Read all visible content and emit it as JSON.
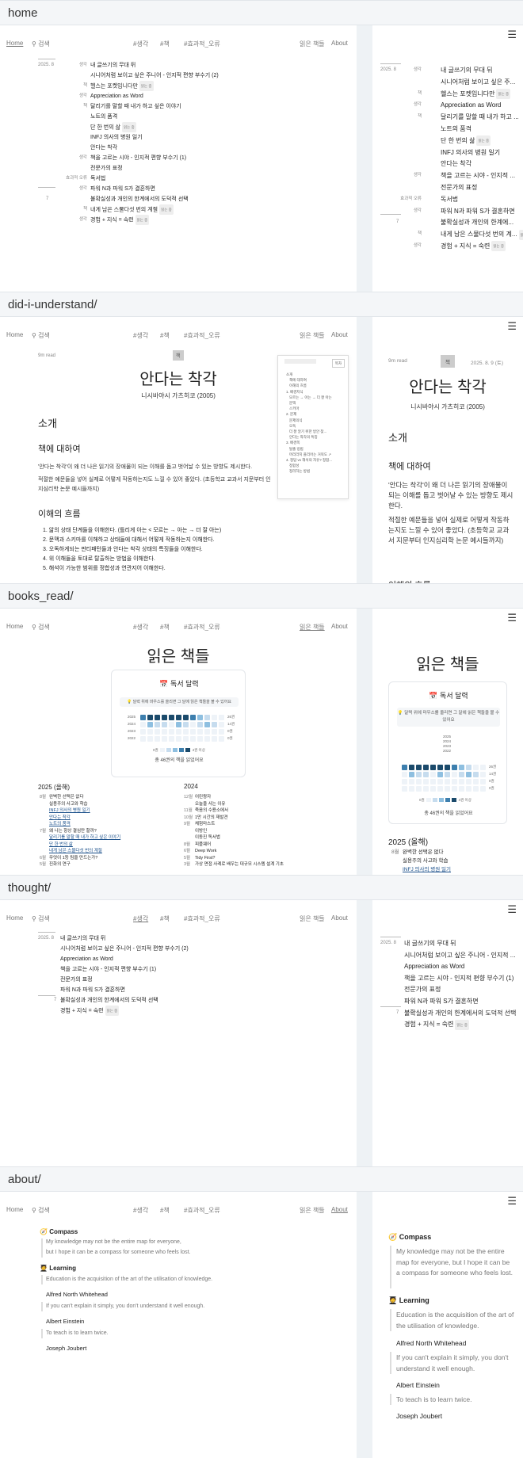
{
  "sections": {
    "home": "home",
    "did_i_understand": "did-i-understand/",
    "books_read": "books_read/",
    "thought": "thought/",
    "about": "about/"
  },
  "nav": {
    "home": "Home",
    "search": "검색",
    "tag_thought": "#생각",
    "tag_book": "#책",
    "tag_effective": "#효과적_오류",
    "books_read": "읽은 책들",
    "about": "About"
  },
  "home_list": {
    "year": "2025. 8",
    "seven": "7",
    "items": [
      {
        "tag": "생각",
        "title": "내 글쓰기의 무대 뒤",
        "badge": ""
      },
      {
        "tag": "",
        "title": "시니어처럼 보이고 싶은 주니어 - 인지적 편향 부수기 (2)",
        "badge": ""
      },
      {
        "tag": "책",
        "title": "헬스는 포켓입니다만",
        "badge": "읽는 중"
      },
      {
        "tag": "생각",
        "title": "Appreciation as Word",
        "badge": ""
      },
      {
        "tag": "책",
        "title": "달리기를 말할 때 내가 하고 싶은 이야기",
        "badge": ""
      },
      {
        "tag": "",
        "title": "노트의 품격",
        "badge": ""
      },
      {
        "tag": "",
        "title": "단 한 번의 삶",
        "badge": "읽는 중"
      },
      {
        "tag": "",
        "title": "INFJ 의사의 병원 일기",
        "badge": ""
      },
      {
        "tag": "",
        "title": "안다는 착각",
        "badge": ""
      },
      {
        "tag": "생각",
        "title": "책을 고르는 시야 - 인지적 편향 부수기 (1)",
        "badge": ""
      },
      {
        "tag": "",
        "title": "전문가의 표정",
        "badge": ""
      },
      {
        "tag": "효과적 오류",
        "title": "독서법",
        "badge": ""
      },
      {
        "tag": "생각",
        "title": "파워 N과 파워 S가 결혼하면",
        "badge": ""
      },
      {
        "tag": "",
        "title": "불확실성과 개인의 한계에서의 도덕적 선택",
        "badge": ""
      },
      {
        "tag": "책",
        "title": "내게 남은 스물다섯 번의 계절",
        "badge": "읽는 중"
      },
      {
        "tag": "생각",
        "title": "경험 + 지식 = 숙련",
        "badge": "읽는 중"
      }
    ],
    "right_items": [
      "내 글쓰기의 무대 뒤",
      "시니어처럼 보이고 싶은 주...",
      "헬스는 포켓입니다만",
      "Appreciation as Word",
      "달리기를 말할 때 내가 하고 ...",
      "노트의 품격",
      "단 한 번의 삶",
      "INFJ 의사의 병원 일기",
      "안다는 착각",
      "책을 고르는 시야 - 인지적 ...",
      "전문가의 표정",
      "독서법",
      "파워 N과 파워 S가 결혼하면",
      "불확실성과 개인의 한계에...",
      "내게 남은 스물다섯 번의 계...",
      "경험 + 지식 = 숙련"
    ]
  },
  "article": {
    "read_time": "9m read",
    "tag": "책",
    "date": "2025. 8. 9 (토)",
    "title": "안다는 착각",
    "subtitle": "니시바야시 가츠히코 (2005)",
    "h_intro": "소개",
    "h_about": "책에 대하여",
    "p1": "'안다는 착각'이 왜 더 나은 읽기의 장애물이 되는 이해를 돕고 벗어날 수 있는 방향도 제시한다.",
    "p2": "적절한 예문들을 넣어 실제로 어떻게 작동하는지도 느낄 수 있어 좋았다. (초등학교 교과서 지문부터 인지심리학 논문 예시들까지)",
    "p1_r": "'안다는 착각'이 왜 더 나은 읽기의 장애물이 되는 이해를 돕고 벗어날 수 있는 방향도 제시한다.",
    "p2_r": "적절한 예문들을 넣어 실제로 어떻게 작동하는지도 느낄 수 있어 좋았다. (초등학교 교과서 지문부터 인지심리학 논문 예시들까지)",
    "h_flow": "이해의 흐름",
    "flow": [
      "1. 앎의 상태 단계들을 이해한다. (틀리게 아는 < 모르는 → 아는 → 더 잘 아는)",
      "2. 문맥과 스키마를 이해하고 상태들에 대해서 어떻게 작동하는지 이해한다.",
      "3. 오독하게되는 판티패턴들과 안다는 착각 상태의 특징들을 이해한다.",
      "4. 위 이해들을 토대로 탈출하는 방법을 이해한다.",
      "5. 해석이 가능한 범위를 정합성과 연관지어 이해한다."
    ],
    "toc_btn": "목차",
    "toc": [
      {
        "t": "소개",
        "sub": false
      },
      {
        "t": "책에 대하여",
        "sub": true
      },
      {
        "t": "이해의 흐름",
        "sub": true
      },
      {
        "t": "1. 배경지식",
        "sub": false
      },
      {
        "t": "모르는 → 아는 → 더 잘 아는",
        "sub": true
      },
      {
        "t": "문맥",
        "sub": true
      },
      {
        "t": "스키마",
        "sub": true
      },
      {
        "t": "2. 문제",
        "sub": false
      },
      {
        "t": "문제의식",
        "sub": true
      },
      {
        "t": "오독",
        "sub": true
      },
      {
        "t": "더 잘 알기 위한 방안 찾...",
        "sub": true
      },
      {
        "t": "안다는 착각의 특징",
        "sub": true
      },
      {
        "t": "3. 배경쪽",
        "sub": false
      },
      {
        "t": "탈출 방법",
        "sub": true
      },
      {
        "t": "머리라지 플리어는 거북도 ↗",
        "sub": true
      },
      {
        "t": "4. 정답 vs 해석의 자유? 정합...",
        "sub": false
      },
      {
        "t": "정합성",
        "sub": true
      },
      {
        "t": "정리하는 방법",
        "sub": true
      }
    ],
    "h_flow_r": "이해의 흐름"
  },
  "books": {
    "title": "읽은 책들",
    "calendar_title": "독서 달력",
    "calendar_icon": "calendar-icon",
    "hint": "달력 위에 마우스를 올리면 그 달에 읽은 책들을 볼 수 있어요",
    "years": [
      "2025",
      "2024",
      "2023",
      "2022"
    ],
    "counts": [
      "26권",
      "14권",
      "0권",
      "0권"
    ],
    "legend_low": "0권",
    "legend_high": "4권 이상",
    "total": "총 46권의 책을 읽었어요",
    "heatmap": [
      [
        3,
        4,
        4,
        4,
        4,
        4,
        4,
        3,
        2,
        1,
        0,
        0
      ],
      [
        0,
        2,
        1,
        1,
        0,
        2,
        1,
        0,
        1,
        2,
        1,
        0
      ],
      [
        0,
        0,
        0,
        0,
        0,
        0,
        0,
        0,
        0,
        0,
        0,
        0
      ],
      [
        0,
        0,
        0,
        0,
        0,
        0,
        0,
        0,
        0,
        0,
        0,
        0
      ]
    ],
    "col_2025": "2025 (올해)",
    "col_2024": "2024",
    "list_2025": [
      {
        "m": "8월",
        "t": "완벽한 선택은 없다",
        "link": false
      },
      {
        "m": "",
        "t": "실용주의 사고와 학습",
        "link": false
      },
      {
        "m": "",
        "t": "INFJ 의사의 병원 일기",
        "link": true
      },
      {
        "m": "",
        "t": "안다는 착각",
        "link": true
      },
      {
        "m": "",
        "t": "노트의 품격",
        "link": true
      },
      {
        "m": "7월",
        "t": "왜 나는 항상 결심만 할까?",
        "link": false
      },
      {
        "m": "",
        "t": "달리기를 말할 때 내가 하고 싶은 이야기",
        "link": true
      },
      {
        "m": "",
        "t": "단 한 번의 삶",
        "link": true
      },
      {
        "m": "",
        "t": "내게 남은 스물다섯 번의 계절",
        "link": true
      },
      {
        "m": "6월",
        "t": "무엇이 1등 팀을 만드는가?",
        "link": false
      },
      {
        "m": "5월",
        "t": "진화의 연구",
        "link": false
      }
    ],
    "list_2024": [
      {
        "m": "12월",
        "t": "어린왕자"
      },
      {
        "m": "",
        "t": "오늘을 사는 이유"
      },
      {
        "m": "11월",
        "t": "죽음의 수용소에서"
      },
      {
        "m": "10월",
        "t": "1만 시간의 재발견"
      },
      {
        "m": "9월",
        "t": "체험마스트"
      },
      {
        "m": "",
        "t": "이방인"
      },
      {
        "m": "",
        "t": "이동진 독서법"
      },
      {
        "m": "8월",
        "t": "피플웨어"
      },
      {
        "m": "6월",
        "t": "Deep Work"
      },
      {
        "m": "5월",
        "t": "Tidy First?"
      },
      {
        "m": "3월",
        "t": "가상 면접 사례로 배우는 대규모 시스템 설계 기초"
      }
    ],
    "right_list": [
      {
        "m": "8월",
        "t": "완벽한 선택은 없다",
        "link": false
      },
      {
        "m": "",
        "t": "실용주의 사고와 학습",
        "link": false
      },
      {
        "m": "",
        "t": "INFJ 의사의 병원 일기",
        "link": true
      }
    ]
  },
  "thought_list": {
    "year": "2025. 8",
    "seven": "7",
    "items": [
      {
        "title": "내 글쓰기의 무대 뒤",
        "badge": ""
      },
      {
        "title": "시니어처럼 보이고 싶은 주니어 - 인지적 편향 부수기 (2)",
        "badge": ""
      },
      {
        "title": "Appreciation as Word",
        "badge": ""
      },
      {
        "title": "책을 고르는 시야 - 인지적 편향 부수기 (1)",
        "badge": ""
      },
      {
        "title": "전문가의 표정",
        "badge": ""
      },
      {
        "title": "파워 N과 파워 S가 결혼하면",
        "badge": ""
      },
      {
        "title": "불확실성과 개인의 한계에서의 도덕적 선택",
        "badge": ""
      },
      {
        "title": "경험 + 지식 = 숙련",
        "badge": "읽는 중"
      }
    ],
    "right_items": [
      "내 글쓰기의 무대 뒤",
      "시니어처럼 보이고 싶은 주니어 - 인지적 ...",
      "Appreciation as Word",
      "책을 고르는 시야 - 인지적 편향 부수기 (1)",
      "전문가의 표정",
      "파워 N과 파워 S가 결혼하면",
      "불확실성과 개인의 한계에서의 도덕적 선택",
      "경험 + 지식 = 숙련"
    ]
  },
  "about_page": {
    "compass_title": "Compass",
    "compass_icon": "compass-icon",
    "compass_l1": "My knowledge may not be the entire map for everyone,",
    "compass_l2": "but I hope it can be a compass for someone who feels lost.",
    "compass_r": "My knowledge may not be the entire map for everyone, but I hope it can be a compass for someone who feels lost.",
    "learning_title": "Learning",
    "learning_icon": "student-icon",
    "q1": "Education is the acquisition of the art of the utilisation of knowledge.",
    "a1": "Alfred North Whitehead",
    "q2": "If you can't explain it simply, you don't understand it well enough.",
    "a2": "Albert Einstein",
    "q3": "To teach is to learn twice.",
    "a3": "Joseph Joubert"
  },
  "colors": {
    "link": "#1a4f8a",
    "heat": [
      "#eef3f8",
      "#c6dcee",
      "#8ebfe0",
      "#3d7fae",
      "#1b4a6b"
    ]
  }
}
